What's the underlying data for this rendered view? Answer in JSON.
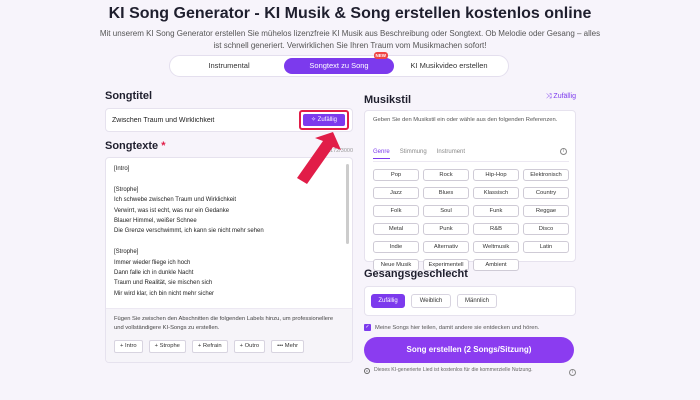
{
  "header": {
    "title": "KI Song Generator - KI Musik & Song erstellen kostenlos online",
    "subtitle": "Mit unserem KI Song Generator erstellen Sie mühelos lizenzfreie KI Musik aus Beschreibung oder Songtext. Ob Melodie oder Gesang – alles ist schnell generiert. Verwirklichen Sie Ihren Traum vom Musikmachen sofort!"
  },
  "tabs": [
    {
      "label": "Instrumental"
    },
    {
      "label": "Songtext zu Song",
      "badge": "NEW"
    },
    {
      "label": "KI Musikvideo erstellen"
    }
  ],
  "songtitle": {
    "heading": "Songtitel",
    "value": "Zwischen Traum und Wirklichkeit",
    "random_label": "Zufällig"
  },
  "songtexte": {
    "heading": "Songtexte",
    "required_mark": "*",
    "counter": "1172/3000",
    "lyrics": "[Intro]\n\n[Strophe]\nIch schwebe zwischen Traum und Wirklichkeit\nVerwirrt, was ist echt, was nur ein Gedanke\nBlauer Himmel, weißer Schnee\nDie Grenze verschwimmt, ich kann sie nicht mehr sehen\n\n[Strophe]\nImmer wieder fliege ich hoch\nDann falle ich in dunkle Nacht\nTraum und Realität, sie mischen sich\nMir wird klar, ich bin nicht mehr sicher\n\n[Refrain]",
    "hint": "Fügen Sie zwischen den Abschnitten die folgenden Labels hinzu, um professionellere und vollständigere KI-Songs zu erstellen.",
    "label_buttons": [
      "+ Intro",
      "+ Strophe",
      "+ Refrain",
      "+ Outro",
      "••• Mehr"
    ]
  },
  "musikstil": {
    "heading": "Musikstil",
    "random_label": "Zufällig",
    "description": "Geben Sie den Musikstil ein oder wähle aus den folgenden Referenzen.",
    "subtabs": [
      "Genre",
      "Stimmung",
      "Instrument"
    ],
    "genres": [
      "Pop",
      "Rock",
      "Hip-Hop",
      "Elektronisch",
      "Jazz",
      "Blues",
      "Klassisch",
      "Country",
      "Folk",
      "Soul",
      "Funk",
      "Reggae",
      "Metal",
      "Punk",
      "R&B",
      "Disco",
      "Indie",
      "Alternativ",
      "Weltmusik",
      "Latin",
      "Neue Musik",
      "Experimentell",
      "Ambient"
    ]
  },
  "voice": {
    "heading": "Gesangsgeschlecht",
    "options": [
      "Zufällig",
      "Weiblich",
      "Männlich"
    ],
    "selected": "Zufällig"
  },
  "share": {
    "label": "Meine Songs hier teilen, damit andere sie entdecken und hören."
  },
  "create_button": "Song erstellen (2 Songs/Sitzung)",
  "footnote": "Dieses KI-generierte Lied ist kostenlos für die kommerzielle Nutzung.",
  "colors": {
    "accent": "#7c3aed",
    "highlight": "#e11d48"
  }
}
